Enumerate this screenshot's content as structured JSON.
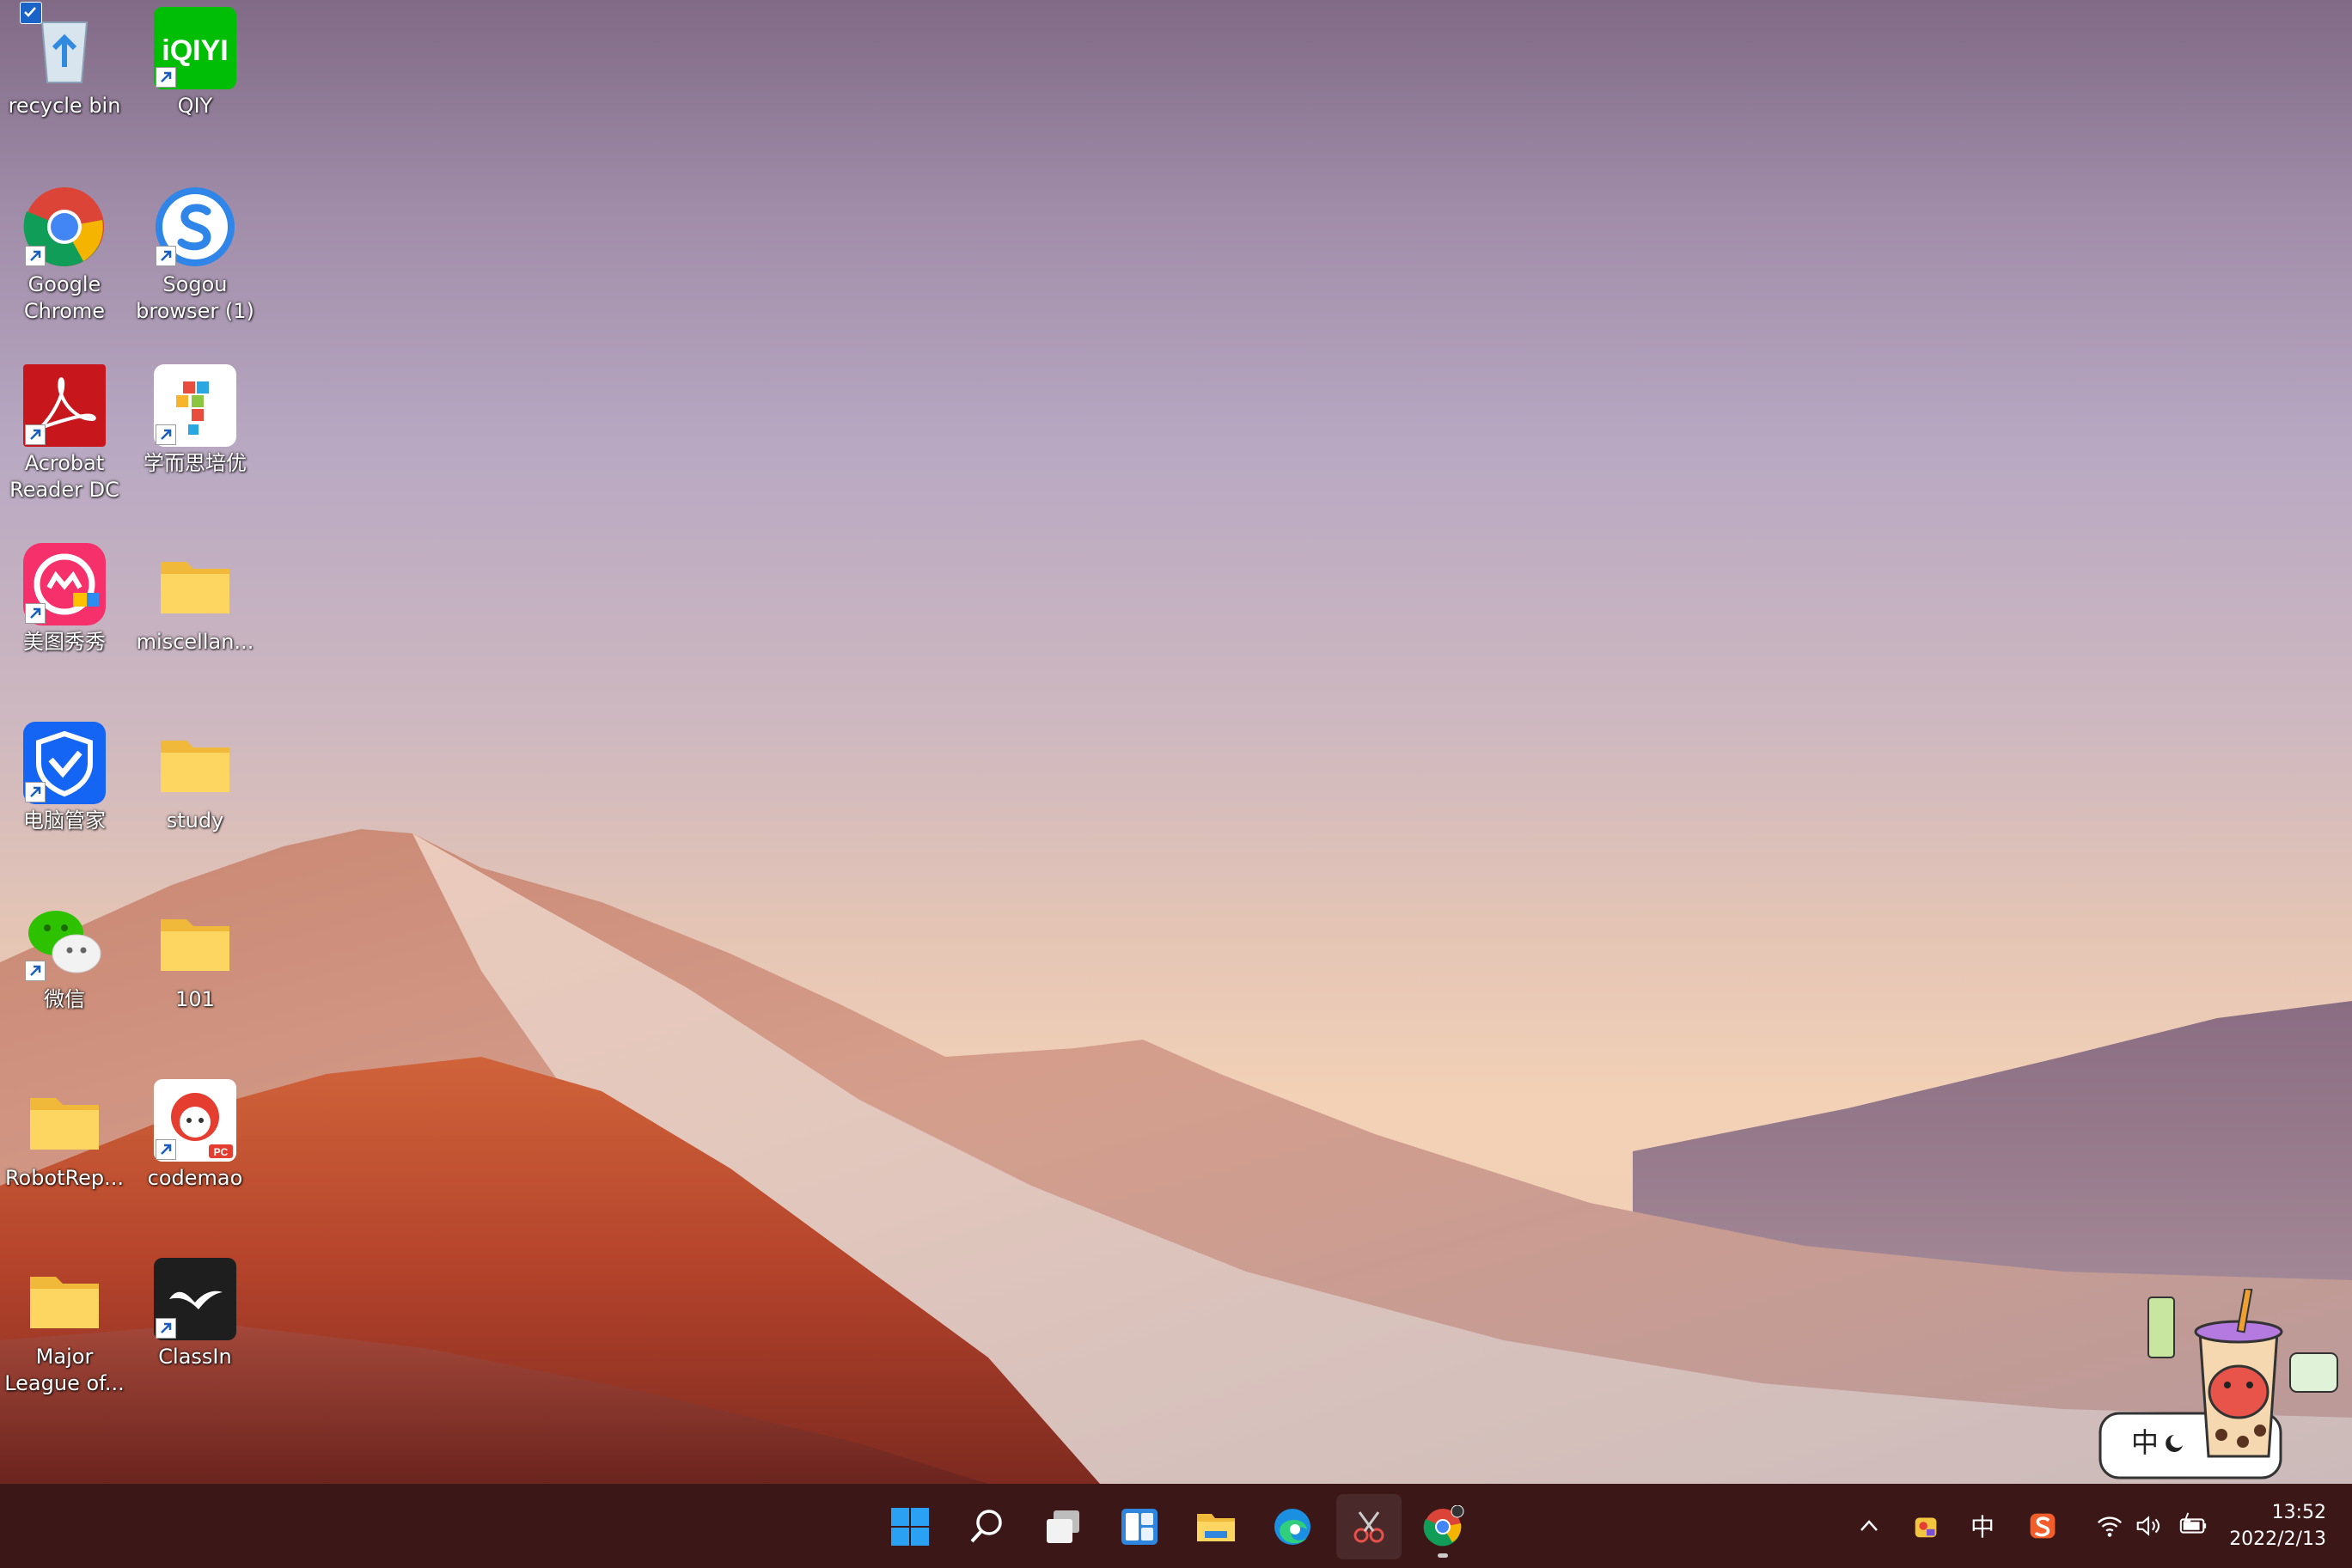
{
  "desktop_icons": [
    {
      "label": "recycle bin",
      "icon": "recycle-bin-icon"
    },
    {
      "label": "QIY",
      "icon": "iqiyi-icon"
    },
    {
      "label": "Google Chrome",
      "icon": "chrome-icon"
    },
    {
      "label": "Sogou browser (1)",
      "icon": "sogou-browser-icon"
    },
    {
      "label": "Acrobat Reader DC",
      "icon": "acrobat-icon"
    },
    {
      "label": "学而思培优",
      "icon": "xueersi-icon"
    },
    {
      "label": "美图秀秀",
      "icon": "meitu-icon"
    },
    {
      "label": "miscellan...",
      "icon": "folder-icon"
    },
    {
      "label": "电脑管家",
      "icon": "pc-manager-icon"
    },
    {
      "label": "study",
      "icon": "folder-icon"
    },
    {
      "label": "微信",
      "icon": "wechat-icon"
    },
    {
      "label": "101",
      "icon": "folder-icon"
    },
    {
      "label": "RobotRep...",
      "icon": "folder-icon"
    },
    {
      "label": "codemao",
      "icon": "codemao-icon"
    },
    {
      "label": "Major League of...",
      "icon": "folder-icon"
    },
    {
      "label": "ClassIn",
      "icon": "classin-icon"
    }
  ],
  "icon_texts": {
    "iqiyi": "iQIYI",
    "codemao_badge": "PC"
  },
  "taskbar": {
    "items": [
      "start-icon",
      "search-icon",
      "task-view-icon",
      "widgets-icon",
      "file-explorer-icon",
      "edge-icon",
      "snipping-tool-icon",
      "chrome-icon"
    ]
  },
  "tray": {
    "ime": "中",
    "clock_time": "13:52",
    "clock_date": "2022/2/13"
  },
  "pet": {
    "ime_mode": "中"
  },
  "colors": {
    "taskbar": "#3b1718",
    "accent": "#0078d4"
  }
}
